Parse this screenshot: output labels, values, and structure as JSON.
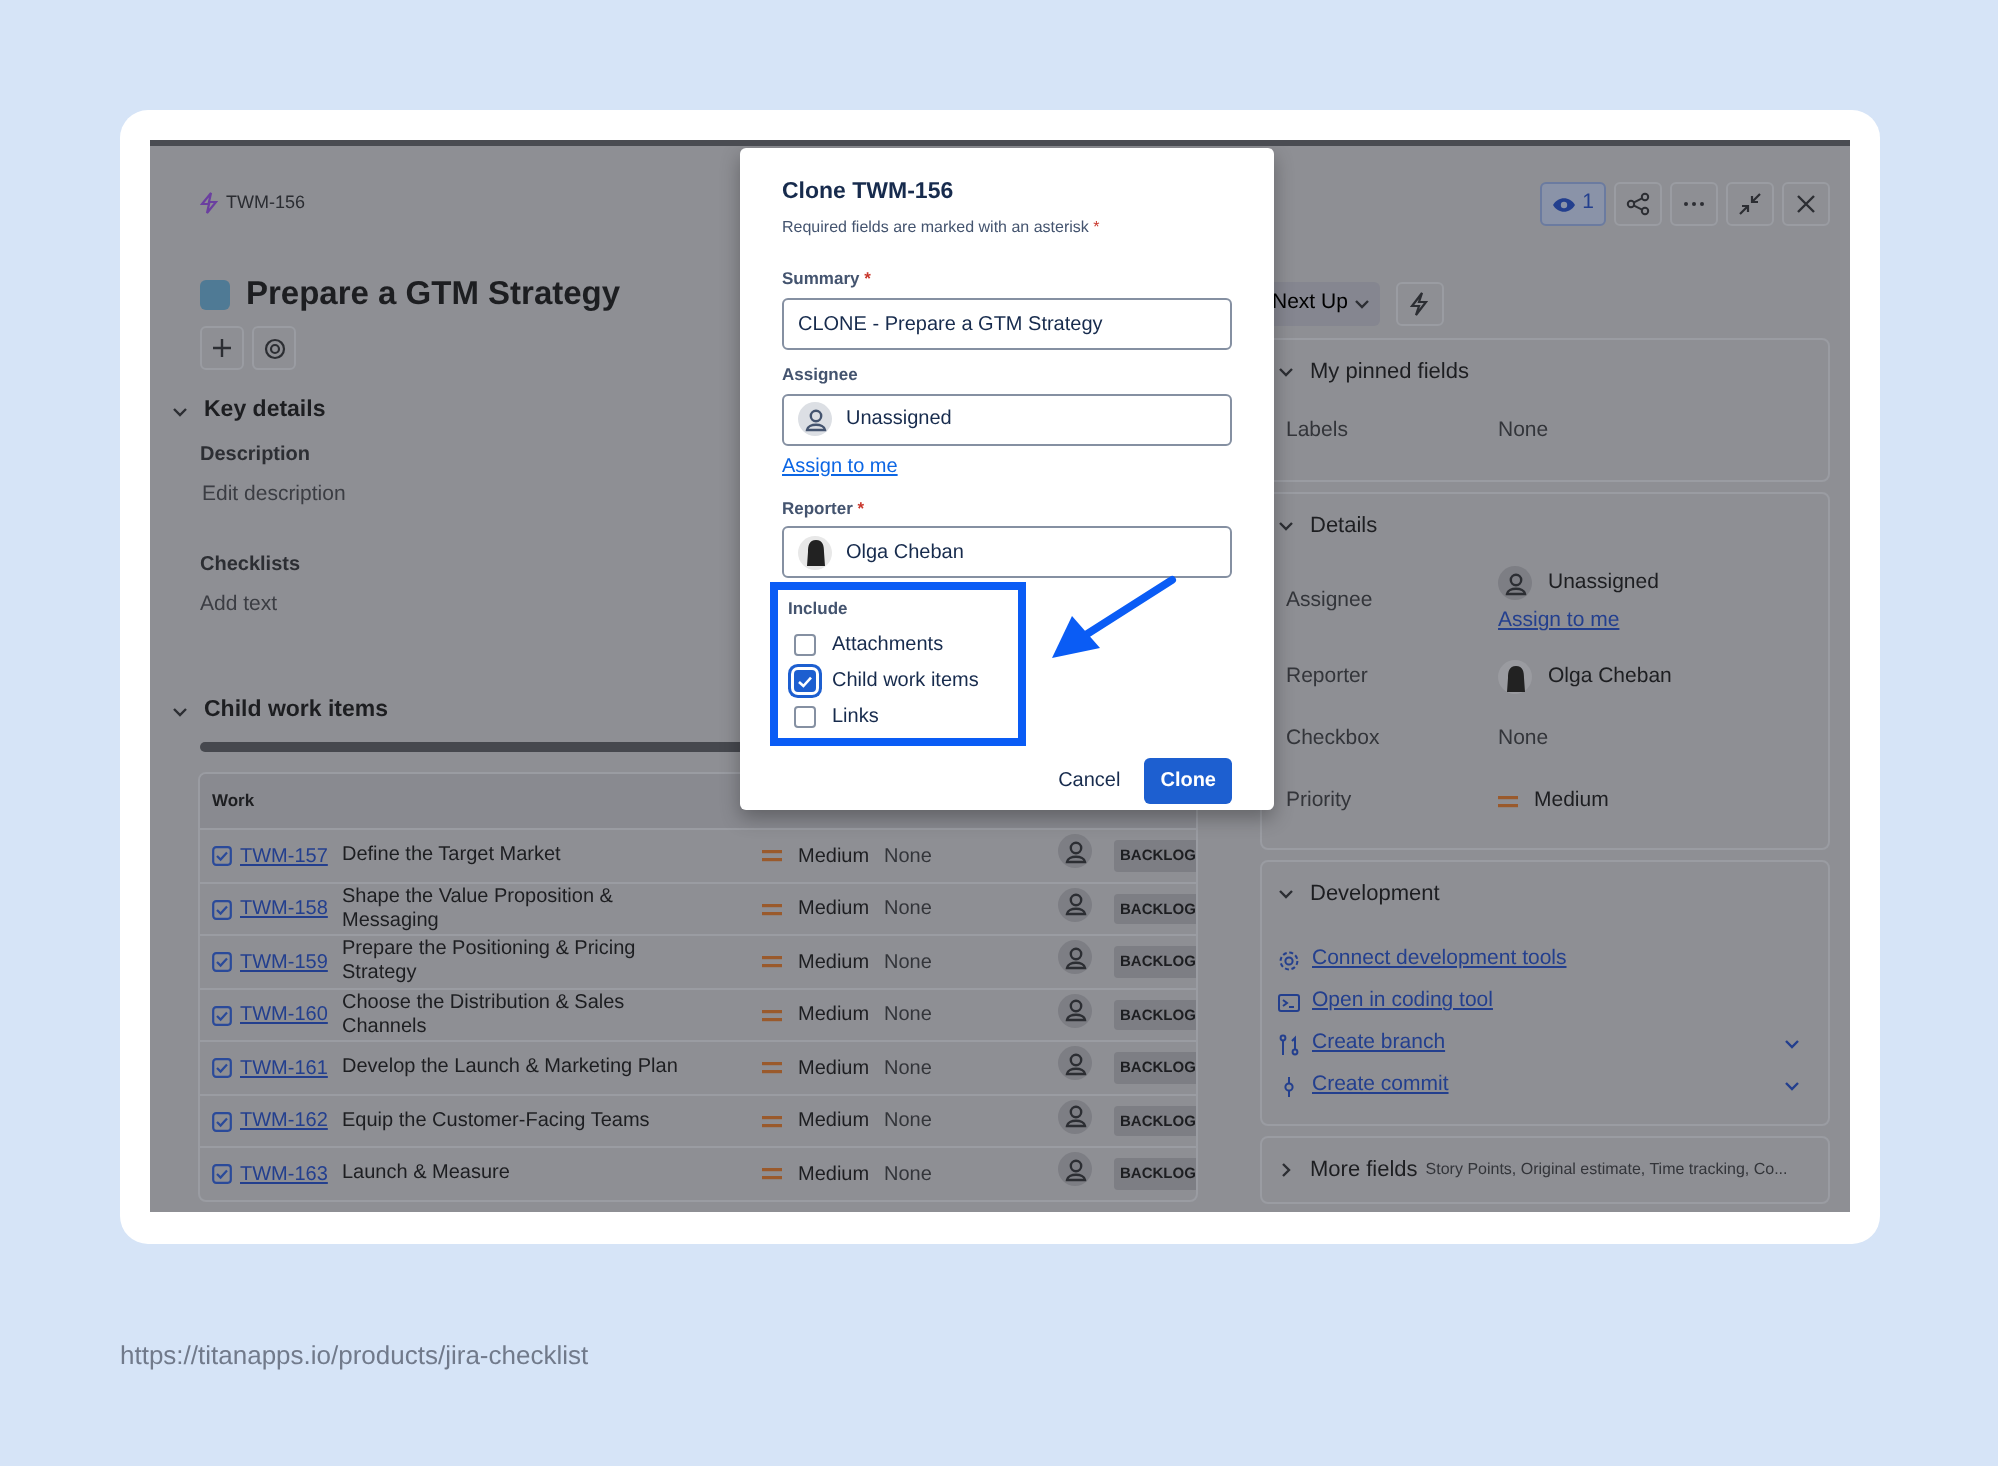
{
  "issue": {
    "key": "TWM-156",
    "title": "Prepare a GTM Strategy"
  },
  "toolbar": {
    "watchers": "1"
  },
  "key_details": {
    "heading": "Key details",
    "expanded": true,
    "fields": [
      {
        "label": "Description",
        "placeholder": "Edit description"
      },
      {
        "label": "Checklists",
        "placeholder": "Add text"
      }
    ]
  },
  "child_work_items": {
    "heading": "Child work items",
    "expanded": true,
    "progress": {
      "level": 0
    },
    "columns": [
      "Work"
    ],
    "rows": [
      {
        "key": "TWM-157",
        "summary": "Define the Target Market",
        "priority": "Medium",
        "column_4": "None",
        "status": "BACKLOG"
      },
      {
        "key": "TWM-158",
        "summary": "Shape the Value Proposition & Messaging",
        "priority": "Medium",
        "column_4": "None",
        "status": "BACKLOG"
      },
      {
        "key": "TWM-159",
        "summary": "Prepare the Positioning & Pricing Strategy",
        "priority": "Medium",
        "column_4": "None",
        "status": "BACKLOG"
      },
      {
        "key": "TWM-160",
        "summary": "Choose the Distribution & Sales Channels",
        "priority": "Medium",
        "column_4": "None",
        "status": "BACKLOG"
      },
      {
        "key": "TWM-161",
        "summary": "Develop the Launch & Marketing Plan",
        "priority": "Medium",
        "column_4": "None",
        "status": "BACKLOG"
      },
      {
        "key": "TWM-162",
        "summary": "Equip the Customer-Facing Teams",
        "priority": "Medium",
        "column_4": "None",
        "status": "BACKLOG"
      },
      {
        "key": "TWM-163",
        "summary": "Launch & Measure",
        "priority": "Medium",
        "column_4": "None",
        "status": "BACKLOG"
      }
    ]
  },
  "status_button": {
    "label": "Next Up"
  },
  "pinned_fields": {
    "heading": "My pinned fields",
    "expanded": true,
    "fields": [
      {
        "label": "Labels",
        "kind": "text",
        "value": "None"
      }
    ]
  },
  "details": {
    "heading": "Details",
    "expanded": true,
    "fields": [
      {
        "label": "Assignee",
        "kind": "user",
        "value": "Unassigned",
        "photo": false,
        "link": "Assign to me"
      },
      {
        "label": "Reporter",
        "kind": "user",
        "value": "Olga Cheban",
        "photo": true
      },
      {
        "label": "Checkbox",
        "kind": "text",
        "value": "None"
      },
      {
        "label": "Priority",
        "kind": "priority",
        "value": "Medium"
      }
    ]
  },
  "development": {
    "heading": "Development",
    "expanded": true,
    "actions": [
      {
        "label": "Connect development tools",
        "kind": "connect",
        "has_menu": false
      },
      {
        "label": "Open in coding tool",
        "kind": "open",
        "has_menu": false
      },
      {
        "label": "Create branch",
        "kind": "branch",
        "has_menu": true
      },
      {
        "label": "Create commit",
        "kind": "commit",
        "has_menu": true
      }
    ]
  },
  "more_fields": {
    "heading": "More fields",
    "summary": "Story Points, Original estimate, Time tracking, Co...",
    "expanded": false
  },
  "dialog": {
    "title": "Clone TWM-156",
    "note": "Required fields are marked with an asterisk",
    "note_mark": "*",
    "fields": [
      {
        "label": "Summary",
        "required_mark": "*",
        "kind": "text",
        "value": "CLONE - Prepare a GTM Strategy"
      },
      {
        "label": "Assignee",
        "kind": "user",
        "photo": false,
        "value": "Unassigned",
        "link": "Assign to me"
      },
      {
        "label": "Reporter",
        "required_mark": "*",
        "kind": "user",
        "photo": true,
        "value": "Olga Cheban"
      }
    ],
    "include": {
      "label": "Include",
      "highlighted": true,
      "options": [
        {
          "label": "Attachments",
          "checked": false
        },
        {
          "label": "Child work items",
          "checked": true
        },
        {
          "label": "Links",
          "checked": false
        }
      ]
    },
    "buttons": [
      {
        "label": "Cancel",
        "kind": "subtle"
      },
      {
        "label": "Clone",
        "kind": "primary"
      }
    ]
  },
  "caption": "https://titanapps.io/products/jira-checklist"
}
